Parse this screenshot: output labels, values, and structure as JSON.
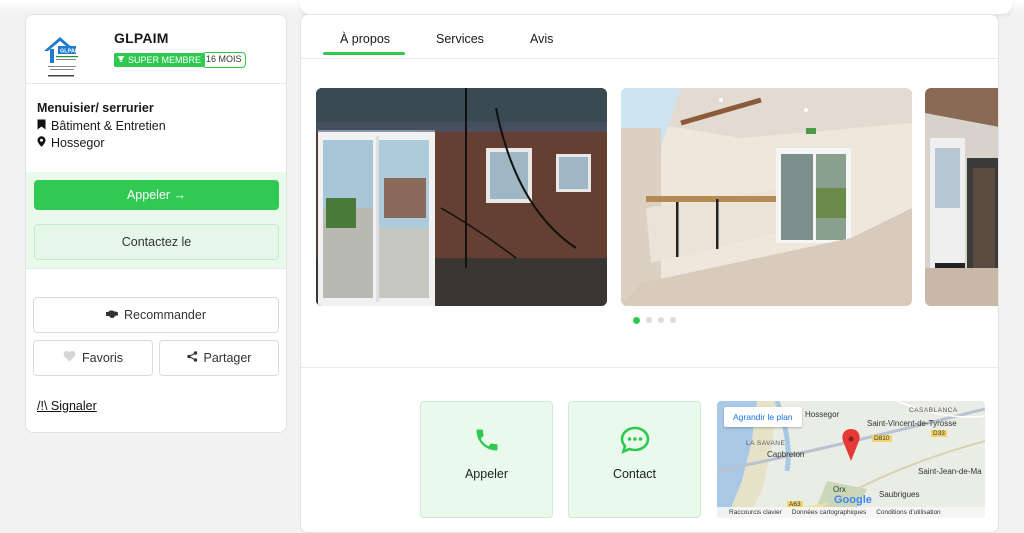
{
  "business": {
    "name": "GLPAIM",
    "logo_text": "GLPAIM",
    "badge_super": "SUPER MEMBRE",
    "badge_months": "16 MOIS",
    "job_title": "Menuisier/ serrurier",
    "category": "Bâtiment & Entretien",
    "location": "Hossegor"
  },
  "actions": {
    "call": "Appeler →",
    "contact": "Contactez le",
    "recommend": "Recommander",
    "favorites": "Favoris",
    "share": "Partager",
    "report": "/!\\ Signaler"
  },
  "tabs": [
    {
      "label": "À propos",
      "active": true
    },
    {
      "label": "Services",
      "active": false
    },
    {
      "label": "Avis",
      "active": false
    }
  ],
  "gallery": {
    "dot_count": 4,
    "active_dot": 0
  },
  "quick_actions": {
    "call_label": "Appeler",
    "contact_label": "Contact"
  },
  "map": {
    "enlarge": "Agrandir le plan",
    "labels": {
      "hossegor": "Hossegor",
      "casablanca": "CASABLANCA",
      "st_vincent": "Saint-Vincent-de-Tyrosse",
      "la_savane": "LA SAVANE",
      "capbreton": "Capbreton",
      "st_jean": "Saint-Jean-de-Ma",
      "orx": "Orx",
      "saubrigues": "Saubrigues",
      "d810": "D810",
      "d33": "D33",
      "a63": "A63"
    },
    "google": "Google",
    "footer": {
      "shortcuts": "Raccourcis clavier",
      "data": "Données cartographiques",
      "terms": "Conditions d'utilisation"
    }
  },
  "colors": {
    "accent": "#2ec94f",
    "accent_light": "#e9f9ec"
  }
}
